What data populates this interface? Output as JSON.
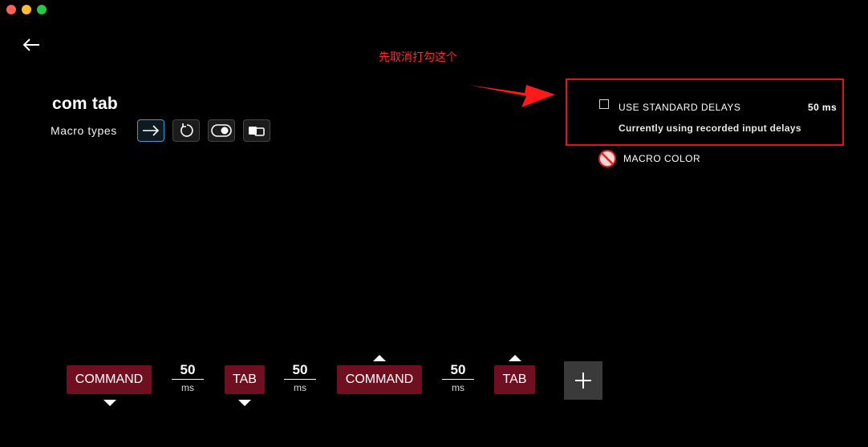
{
  "window": {
    "traffic_lights": [
      "close",
      "minimize",
      "zoom"
    ]
  },
  "annotation": {
    "text": "先取消打勾这个",
    "color": "#ff2a2a"
  },
  "macro": {
    "name": "com tab",
    "types_label": "Macro types",
    "types": [
      "arrow-right-icon",
      "repeat-icon",
      "toggle-icon",
      "sequence-icon"
    ],
    "selected_type": 0
  },
  "settings": {
    "use_standard_delays_label": "USE STANDARD DELAYS",
    "use_standard_delays_checked": false,
    "standard_delay_value": "50 ms",
    "delay_note": "Currently using recorded input delays",
    "macro_color_label": "MACRO COLOR",
    "highlight_color": "#e0141e"
  },
  "sequence": [
    {
      "type": "key",
      "label": "COMMAND",
      "direction": "down"
    },
    {
      "type": "delay",
      "value": "50",
      "unit": "ms"
    },
    {
      "type": "key",
      "label": "TAB",
      "direction": "down"
    },
    {
      "type": "delay",
      "value": "50",
      "unit": "ms"
    },
    {
      "type": "key",
      "label": "COMMAND",
      "direction": "up"
    },
    {
      "type": "delay",
      "value": "50",
      "unit": "ms"
    },
    {
      "type": "key",
      "label": "TAB",
      "direction": "up"
    }
  ],
  "colors": {
    "key_chip": "#700f1f",
    "accent_selected": "#2fa0d6",
    "add_button": "#3a3a3a"
  }
}
